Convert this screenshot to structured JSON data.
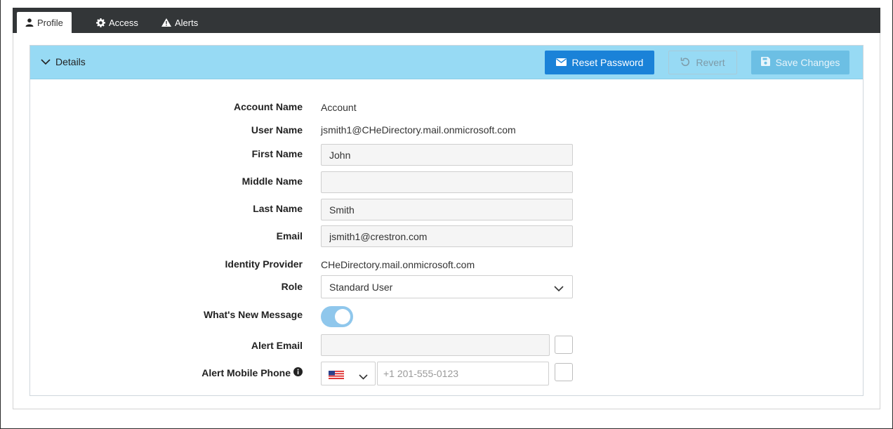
{
  "tabs": [
    {
      "label": "Profile",
      "icon": "user-icon",
      "active": true
    },
    {
      "label": "Access",
      "icon": "gear-icon",
      "active": false
    },
    {
      "label": "Alerts",
      "icon": "warning-icon",
      "active": false
    }
  ],
  "details": {
    "title": "Details",
    "reset_password_label": "Reset Password",
    "revert_label": "Revert",
    "save_changes_label": "Save Changes"
  },
  "form": {
    "account_name": {
      "label": "Account Name",
      "value": "Account"
    },
    "user_name": {
      "label": "User Name",
      "value": "jsmith1@CHeDirectory.mail.onmicrosoft.com"
    },
    "first_name": {
      "label": "First Name",
      "value": "John"
    },
    "middle_name": {
      "label": "Middle Name",
      "value": ""
    },
    "last_name": {
      "label": "Last Name",
      "value": "Smith"
    },
    "email": {
      "label": "Email",
      "value": "jsmith1@crestron.com"
    },
    "identity_provider": {
      "label": "Identity Provider",
      "value": "CHeDirectory.mail.onmicrosoft.com"
    },
    "role": {
      "label": "Role",
      "value": "Standard User"
    },
    "whats_new": {
      "label": "What's New Message",
      "on": true
    },
    "alert_email": {
      "label": "Alert Email",
      "value": "",
      "checked": false
    },
    "alert_phone": {
      "label": "Alert Mobile Phone",
      "country": "US",
      "placeholder": "+1 201-555-0123",
      "value": "",
      "checked": false
    }
  },
  "colors": {
    "tabbar": "#333638",
    "header": "#97daf4",
    "primary_button": "#1a82d8",
    "disabled_button": "#6cbfe4",
    "toggle_on": "#8fc7ec"
  }
}
